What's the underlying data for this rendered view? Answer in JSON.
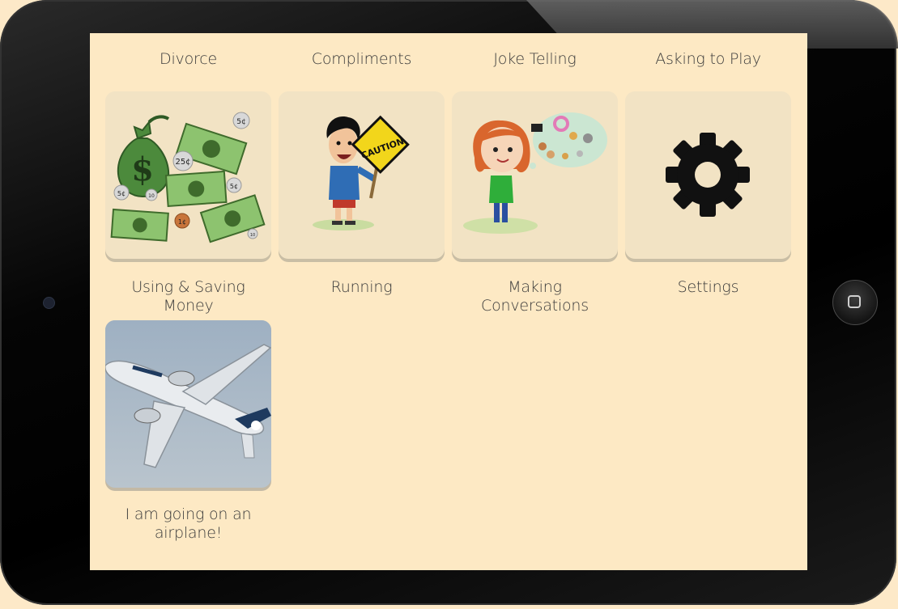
{
  "top_labels": [
    "Divorce",
    "Compliments",
    "Joke Telling",
    "Asking to Play"
  ],
  "row1": [
    {
      "label": "Using & Saving Money",
      "icon": "money-icon"
    },
    {
      "label": "Running",
      "icon": "caution-sign-boy-icon",
      "sign_text": "CAUTION"
    },
    {
      "label": "Making Conversations",
      "icon": "girl-thinking-icon"
    },
    {
      "label": "Settings",
      "icon": "gear-icon"
    }
  ],
  "row2": [
    {
      "label": "I am going on an airplane!",
      "icon": "airplane-icon"
    }
  ],
  "money_icon_text": [
    "$",
    "5¢",
    "25¢",
    "5¢",
    "10",
    "5¢",
    "1¢",
    "10"
  ],
  "colors": {
    "screen": "#fde9c4",
    "tile": "#f2e3c4",
    "text": "#3b3b3b"
  }
}
